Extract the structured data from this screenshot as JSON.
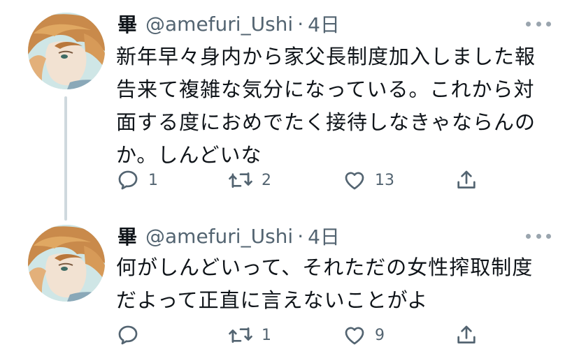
{
  "colors": {
    "text": "#0f1419",
    "secondary": "#536471",
    "thread_line": "#cfd9de"
  },
  "tweets": [
    {
      "display_name": "畢",
      "handle": "@amefuri_Ushi",
      "separator": "·",
      "time": "4日",
      "text": "新年早々身内から家父長制度加入しました報\n告来て複雑な気分になっている。これから対\n面する度におめでたく接待しなきゃならんの\nか。しんどいな",
      "reply_count": "1",
      "retweet_count": "2",
      "like_count": "13",
      "icons": [
        "more-icon",
        "reply-icon",
        "retweet-icon",
        "like-icon",
        "share-icon"
      ]
    },
    {
      "display_name": "畢",
      "handle": "@amefuri_Ushi",
      "separator": "·",
      "time": "4日",
      "text": "何がしんどいって、それただの女性搾取制度\nだよって正直に言えないことがよ",
      "reply_count": "",
      "retweet_count": "1",
      "like_count": "9",
      "icons": [
        "more-icon",
        "reply-icon",
        "retweet-icon",
        "like-icon",
        "share-icon"
      ]
    }
  ]
}
